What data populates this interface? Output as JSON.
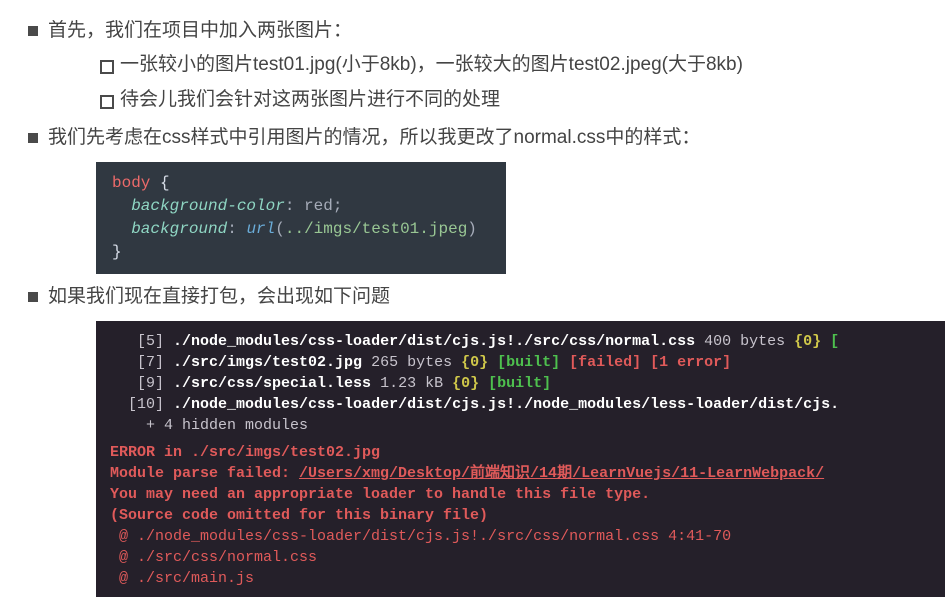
{
  "bullets": {
    "item1": "首先，我们在项目中加入两张图片：",
    "item1_sub1": "一张较小的图片test01.jpg(小于8kb)，一张较大的图片test02.jpeg(大于8kb)",
    "item1_sub2": "待会儿我们会针对这两张图片进行不同的处理",
    "item2": "我们先考虑在css样式中引用图片的情况，所以我更改了normal.css中的样式：",
    "item3": "如果我们现在直接打包，会出现如下问题"
  },
  "css_code": {
    "selector": "body",
    "prop1": "background-color",
    "val1": "red",
    "prop2": "background",
    "fn": "url",
    "arg": "../imgs/test01.jpeg"
  },
  "terminal": {
    "l5_idx": "[5] ",
    "l5_path": "./node_modules/css-loader/dist/cjs.js!./src/css/normal.css",
    "l5_tail1": " 400 bytes ",
    "l5_brace0": "{0}",
    "l5_tail2": " [",
    "l7_idx": "[7] ",
    "l7_path": "./src/imgs/test02.jpg",
    "l7_tail1": " 265 bytes ",
    "l7_brace0": "{0}",
    "l7_built": " [built]",
    "l7_failed": " [failed]",
    "l7_err": " [1 error]",
    "l9_idx": "[9] ",
    "l9_path": "./src/css/special.less",
    "l9_tail1": " 1.23 kB ",
    "l9_brace0": "{0}",
    "l9_built": " [built]",
    "l10_idx": "[10] ",
    "l10_path": "./node_modules/css-loader/dist/cjs.js!./node_modules/less-loader/dist/cjs.",
    "hidden": "    + 4 hidden modules",
    "err1a": "ERROR in ",
    "err1b": "./src/imgs/test02.jpg",
    "err2a": "Module parse failed: ",
    "err2b": "/Users/xmg/Desktop/前端知识/14期/LearnVuejs/11-LearnWebpack/",
    "err3": "You may need an appropriate loader to handle this file type.",
    "err4": "(Source code omitted for this binary file)",
    "err5": " @ ./node_modules/css-loader/dist/cjs.js!./src/css/normal.css 4:41-70",
    "err6": " @ ./src/css/normal.css",
    "err7": " @ ./src/main.js"
  }
}
